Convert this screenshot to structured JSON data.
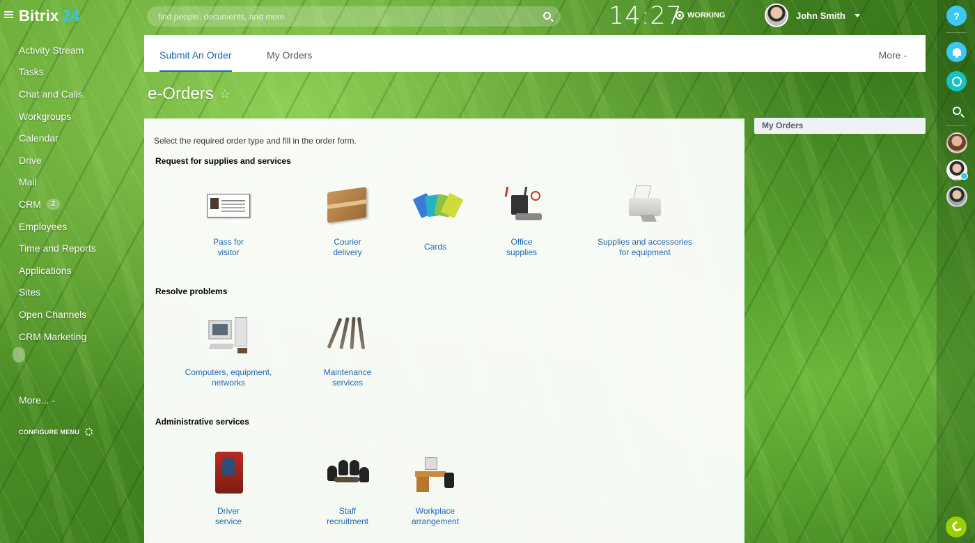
{
  "brand": {
    "name": "Bitrix",
    "suffix": "24"
  },
  "sidebar": {
    "items": [
      {
        "label": "Activity Stream"
      },
      {
        "label": "Tasks"
      },
      {
        "label": "Chat and Calls"
      },
      {
        "label": "Workgroups"
      },
      {
        "label": "Calendar"
      },
      {
        "label": "Drive"
      },
      {
        "label": "Mail"
      },
      {
        "label": "CRM",
        "counter": "2"
      },
      {
        "label": "Employees"
      },
      {
        "label": "Time and Reports"
      },
      {
        "label": "Applications"
      },
      {
        "label": "Sites"
      },
      {
        "label": "Open Channels"
      },
      {
        "label": "CRM Marketing"
      }
    ],
    "more_label": "More...",
    "configure_label": "CONFIGURE MENU"
  },
  "header": {
    "search_placeholder": "find people, documents, and more",
    "clock": "14:27",
    "status": "WORKING",
    "user_name": "John Smith"
  },
  "tabs": [
    {
      "label": "Submit An Order",
      "active": true
    },
    {
      "label": "My Orders",
      "active": false
    }
  ],
  "tabs_more_label": "More",
  "page_title": "e-Orders",
  "content": {
    "intro": "Select the required order type and fill in the order form.",
    "sections": [
      {
        "title": "Request for supplies and services",
        "items": [
          {
            "label": "Pass for\nvisitor",
            "icon": "visitor-pass-icon"
          },
          {
            "label": "Courier\ndelivery",
            "icon": "courier-box-icon"
          },
          {
            "label": "Cards",
            "icon": "cards-icon"
          },
          {
            "label": "Office\nsupplies",
            "icon": "office-supplies-icon"
          },
          {
            "label": "Supplies and accessories\nfor equipment",
            "icon": "printer-icon"
          }
        ]
      },
      {
        "title": "Resolve problems",
        "items": [
          {
            "label": "Computers, equipment,\nnetworks",
            "icon": "computer-icon"
          },
          {
            "label": "Maintenance\nservices",
            "icon": "wrenches-icon"
          }
        ]
      },
      {
        "title": "Administrative services",
        "items": [
          {
            "label": "Driver\nservice",
            "icon": "driver-icon"
          },
          {
            "label": "Staff\nrecruitment",
            "icon": "meeting-icon"
          },
          {
            "label": "Workplace\narrangement",
            "icon": "desk-icon"
          }
        ]
      }
    ]
  },
  "widget": {
    "title": "My Orders"
  },
  "right_rail": {
    "help_label": "?",
    "icons": [
      "help-icon",
      "bell-icon",
      "chat-icon",
      "search-icon",
      "phone-icon"
    ]
  }
}
